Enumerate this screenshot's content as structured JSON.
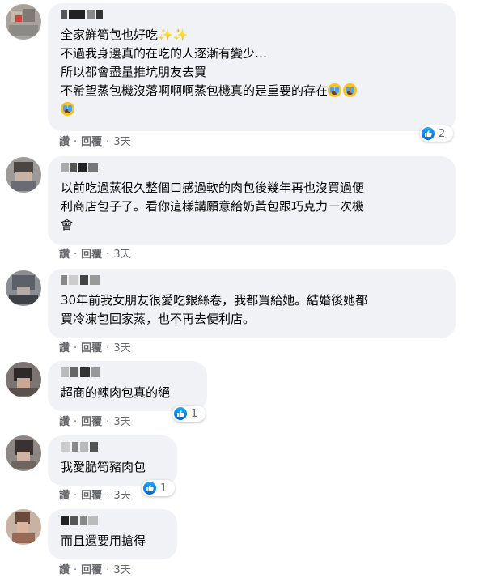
{
  "actions": {
    "like": "讚",
    "reply": "回覆",
    "time": "3天",
    "sep": "·"
  },
  "comments": [
    {
      "lines": [
        "全家鮮筍包也好吃",
        "不過我身邊真的在吃的人逐漸有變少…",
        "所以都會盡量推坑朋友去買",
        "不希望蒸包機沒落啊啊啊蒸包機真的是重要的存在"
      ],
      "emojis": [
        "sparkles-emoji",
        "crying-face-emoji"
      ],
      "reactions": "2"
    },
    {
      "lines": [
        "以前吃過蒸很久整個口感過軟的肉包後幾年再也沒買過便",
        "利商店包子了。看你這樣講願意給奶黃包跟巧克力一次機",
        "會"
      ]
    },
    {
      "lines": [
        "30年前我女朋友很愛吃銀絲卷，我都買給她。結婚後她都",
        "買冷凍包回家蒸，也不再去便利店。"
      ]
    },
    {
      "lines": [
        "超商的辣肉包真的絕"
      ],
      "reactions": "1"
    },
    {
      "lines": [
        "我愛脆筍豬肉包"
      ],
      "reactions": "1"
    },
    {
      "lines": [
        "而且還要用搶得"
      ]
    }
  ],
  "icons": {
    "like": "thumbs-up-icon",
    "avatar": "blurred-avatar",
    "name": "blurred-username"
  },
  "colors": {
    "bubble": "#f0f2f5",
    "meta_text": "#65676b",
    "like_blue": "#1877f2"
  }
}
